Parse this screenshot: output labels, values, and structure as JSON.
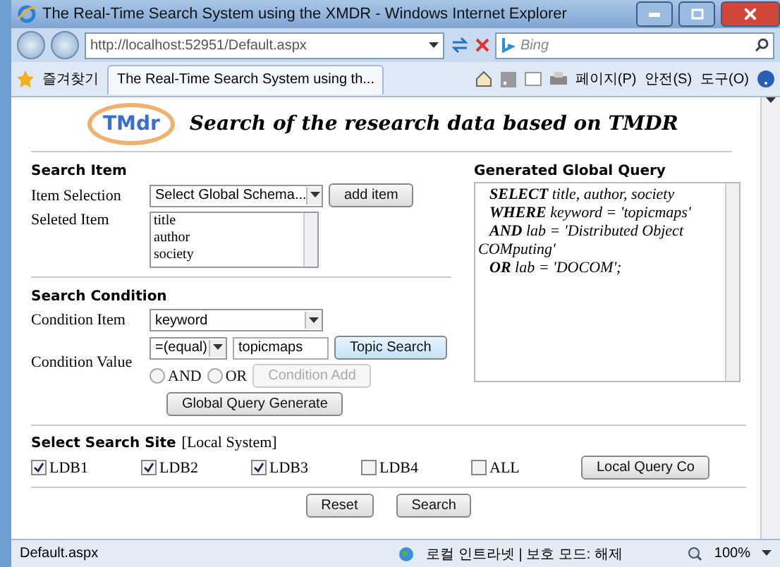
{
  "window": {
    "title": "The Real-Time Search System using the XMDR - Windows Internet Explorer"
  },
  "toolbar": {
    "address": "http://localhost:52951/Default.aspx",
    "search_placeholder": "Bing"
  },
  "favorites": {
    "label": "즐겨찾기",
    "tab": "The Real-Time Search System using th...",
    "menus": [
      "페이지(P)",
      "안전(S)",
      "도구(O)"
    ]
  },
  "header": {
    "logo": "TMdr",
    "title": "Search of the research data based on TMDR"
  },
  "search_item": {
    "heading": "Search Item",
    "selection_label": "Item Selection",
    "selection_value": "Select Global Schema...",
    "add_button": "add item",
    "selected_label": "Seleted Item",
    "items": [
      "title",
      "author",
      "society"
    ]
  },
  "search_condition": {
    "heading": "Search Condition",
    "item_label": "Condition Item",
    "item_value": "keyword",
    "value_label": "Condition Value",
    "operator": "=(equal)",
    "value": "topicmaps",
    "topic_button": "Topic Search",
    "connectors": [
      {
        "label": "AND",
        "selected": false
      },
      {
        "label": "OR",
        "selected": false
      }
    ],
    "condition_add": {
      "label": "Condition Add",
      "disabled": true
    },
    "generate_button": "Global Query Generate"
  },
  "query": {
    "heading": "Generated Global Query",
    "lines": [
      {
        "text": "**SELECT** title, author, society",
        "indent": true
      },
      {
        "text": "**WHERE** keyword = 'topicmaps'",
        "indent": true
      },
      {
        "text": "**AND** lab = 'Distributed Object",
        "indent": true
      },
      {
        "text": "COMputing'",
        "indent": false
      },
      {
        "text": "**OR** lab = 'DOCOM';",
        "indent": true
      }
    ]
  },
  "search_site": {
    "heading": "Select Search Site",
    "note": "[Local System]",
    "sites": [
      {
        "label": "LDB1",
        "checked": true
      },
      {
        "label": "LDB2",
        "checked": true
      },
      {
        "label": "LDB3",
        "checked": true
      },
      {
        "label": "LDB4",
        "checked": false
      },
      {
        "label": "ALL",
        "checked": false
      }
    ],
    "local_button": "Local Query Co"
  },
  "buttons": [
    "Reset",
    "Search"
  ],
  "status_bar": {
    "page": "Default.aspx",
    "zone": "로컬 인트라넷 | 보호 모드: 해제",
    "zoom": "100%"
  }
}
